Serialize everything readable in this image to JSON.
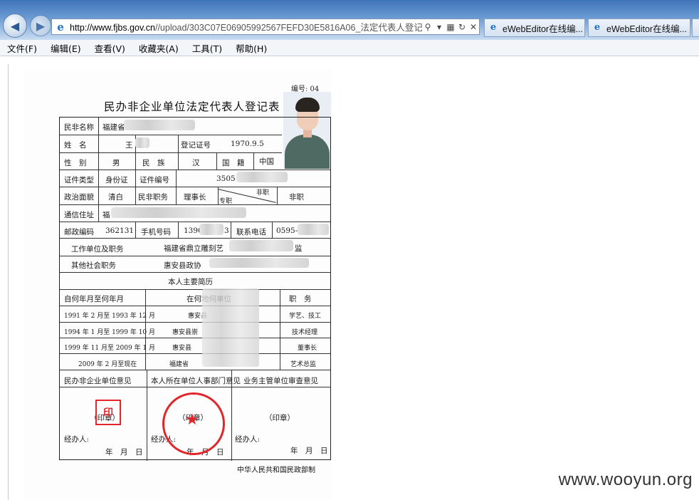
{
  "browser": {
    "url_domain": "http://www.fjbs.gov.cn",
    "url_rest": "//upload/303C07E06905992567FEFD30E5816A06_法定代表人登记",
    "tabs": [
      {
        "label": "eWebEditor在线编..."
      },
      {
        "label": "eWebEditor在线编..."
      }
    ],
    "menu": [
      "文件(F)",
      "编辑(E)",
      "查看(V)",
      "收藏夹(A)",
      "工具(T)",
      "帮助(H)"
    ]
  },
  "document": {
    "title": "民办非企业单位法定代表人登记表",
    "number_label": "编号: 04",
    "rows": {
      "org_name_label": "民非名称",
      "org_name_value": "福建省",
      "name_label": "姓　名",
      "name_value": "王",
      "reg_no_label": "登记证号",
      "reg_no_value": "1970.9.5",
      "gender_label": "性　别",
      "gender_value": "男",
      "ethnicity_label": "民　族",
      "ethnicity_value": "汉",
      "nationality_label": "国　籍",
      "nationality_value": "中国",
      "id_type_label": "证件类型",
      "id_type_value": "身份证",
      "id_no_label": "证件编号",
      "id_no_value": "3505",
      "political_label": "政治面貌",
      "political_value": "清白",
      "post_label": "民非职务",
      "post_value": "理事长",
      "zhuanzhi": "专职",
      "feizhi": "非职",
      "feizhi2": "非职",
      "address_label": "通信住址",
      "address_value": "福",
      "postcode_label": "邮政编码",
      "postcode_value": "362131",
      "mobile_label": "手机号码",
      "mobile_value": "1390",
      "mobile_tail": "3",
      "phone_label": "联系电话",
      "phone_value": "0595-",
      "work_label": "工作单位及职务",
      "work_value": "福建省鼎立雕刻艺",
      "work_tail": "监",
      "social_label": "其他社会职务",
      "social_value": "惠安县政协",
      "resume_title": "本人主要简历",
      "resume_head": [
        "自何年月至何年月",
        "在何地何单位",
        "职　务"
      ],
      "resume": [
        {
          "period": "1991 年 2 月至 1993 年 12 月",
          "place": "惠安县",
          "role": "学艺、技工"
        },
        {
          "period": "1994 年 1 月至 1999 年 10 月",
          "place": "惠安县崇",
          "role": "技术经理"
        },
        {
          "period": "1999 年 11 月至 2009 年 1 月",
          "place": "惠安县",
          "role": "董事长"
        },
        {
          "period": "2009 年 2 月至现在",
          "place": "福建省",
          "role": "艺术总监"
        }
      ],
      "opinion_heads": [
        "民办非企业单位意见",
        "本人所在单位人事部门意见",
        "业务主管单位审查意见"
      ],
      "seal_label": "（印章）",
      "handler_label": "经办人:",
      "date_label": "年　月　日"
    },
    "ministry": "中华人民共和国民政部制"
  },
  "watermark": "www.wooyun.org",
  "colors": {
    "seal": "#e0262a",
    "chrome": "#3f74b8"
  }
}
